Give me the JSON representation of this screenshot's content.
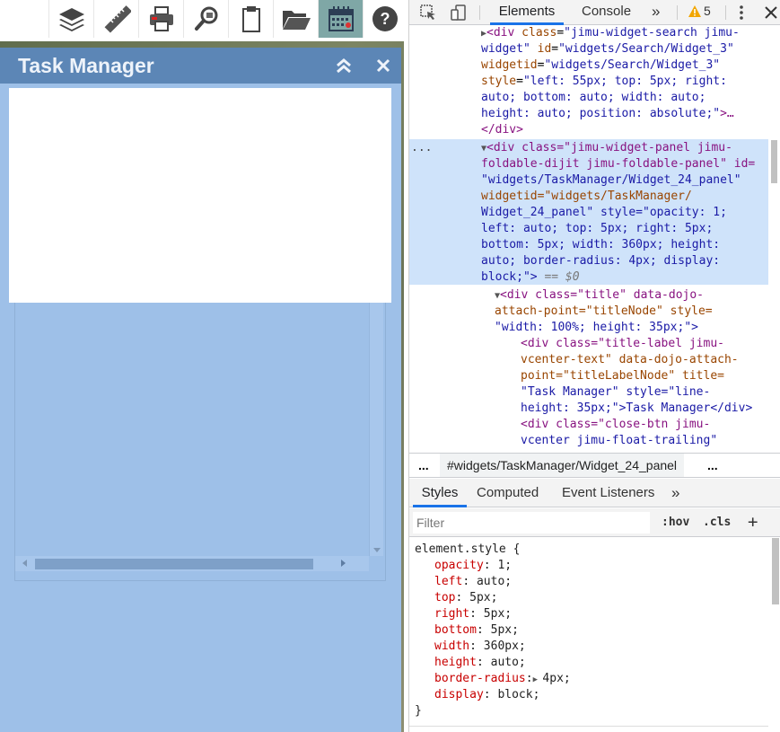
{
  "toolbar": {
    "buttons": [
      {
        "icon": "layers-icon"
      },
      {
        "icon": "measure-ruler-icon"
      },
      {
        "icon": "print-icon"
      },
      {
        "icon": "search-query-icon"
      },
      {
        "icon": "clipboard-icon"
      },
      {
        "icon": "folder-open-icon"
      },
      {
        "icon": "calendar-task-icon",
        "active": true
      },
      {
        "icon": "help-icon",
        "label": "?"
      }
    ]
  },
  "panel": {
    "title": "Task Manager",
    "fold_icon": "chevron-double-up-icon",
    "close_label": "✕"
  },
  "devtools": {
    "tabs": {
      "elements": "Elements",
      "console": "Console",
      "more": "»",
      "warning_count": "5"
    },
    "dom": {
      "node1": {
        "open_tag": "<div",
        "attr1_name": "class",
        "attr1_val": "\"jimu-widget-search jimu-",
        "attr1_val2": "widget\"",
        "attr2_name": "id",
        "attr2_val": "\"widgets/Search/Widget_3\"",
        "attr3_name": "widgetid",
        "attr3_val": "\"widgets/Search/Widget_3\"",
        "attr4_name": "style",
        "attr4_val1": "\"left: 55px; top: 5px; right:",
        "attr4_val2": "auto; bottom: auto; width: auto;",
        "attr4_val3": "height: auto; position: absolute;\"",
        "ellipsis": ">…",
        "close": "</div>"
      },
      "node2": {
        "line1": "<div class=\"jimu-widget-panel jimu-",
        "line2": "foldable-dijit jimu-foldable-panel\" id=",
        "line3": "\"widgets/TaskManager/Widget_24_panel\"",
        "line4": "widgetid=\"widgets/TaskManager/",
        "line5": "Widget_24_panel\" style=\"opacity: 1;",
        "line6": "left: auto; top: 5px; right: 5px;",
        "line7": "bottom: 5px; width: 360px; height:",
        "line8": "auto; border-radius: 4px; display:",
        "line9": "block;\">",
        "eq": " == $0",
        "gutter": "..."
      },
      "node3": {
        "line1": "<div class=\"title\" data-dojo-",
        "line2": "attach-point=\"titleNode\" style=",
        "line3": "\"width: 100%; height: 35px;\">"
      },
      "node4": {
        "line1": "<div class=\"title-label jimu-",
        "line2": "vcenter-text\" data-dojo-attach-",
        "line3": "point=\"titleLabelNode\" title=",
        "line4": "\"Task Manager\" style=\"line-",
        "line5": "height: 35px;\">Task Manager</div>"
      },
      "node5": {
        "line1": "<div class=\"close-btn jimu-",
        "line2": "vcenter jimu-float-trailing\""
      }
    },
    "breadcrumb": {
      "left_ellipsis": "...",
      "path": "#widgets/TaskManager/Widget_24_panel",
      "right_ellipsis": "..."
    },
    "styles_tabs": {
      "styles": "Styles",
      "computed": "Computed",
      "event_listeners": "Event Listeners",
      "more": "»"
    },
    "filter": {
      "placeholder": "Filter",
      "hov": ":hov",
      "cls": ".cls",
      "add": "+"
    },
    "styles": {
      "selector": "element.style {",
      "close": "}",
      "properties": [
        {
          "name": "opacity",
          "value": "1;"
        },
        {
          "name": "left",
          "value": "auto;"
        },
        {
          "name": "top",
          "value": "5px;"
        },
        {
          "name": "right",
          "value": "5px;"
        },
        {
          "name": "bottom",
          "value": "5px;"
        },
        {
          "name": "width",
          "value": "360px;"
        },
        {
          "name": "height",
          "value": "auto;"
        },
        {
          "name": "border-radius",
          "value": "4px;"
        },
        {
          "name": "display",
          "value": "block;"
        }
      ]
    }
  },
  "colors": {
    "panel_title_bg": "#5c86b6",
    "panel_body_bg": "#9ec0e8",
    "active_tab_underline": "#1a73e8",
    "selected_node_bg": "#cfe3fa"
  }
}
